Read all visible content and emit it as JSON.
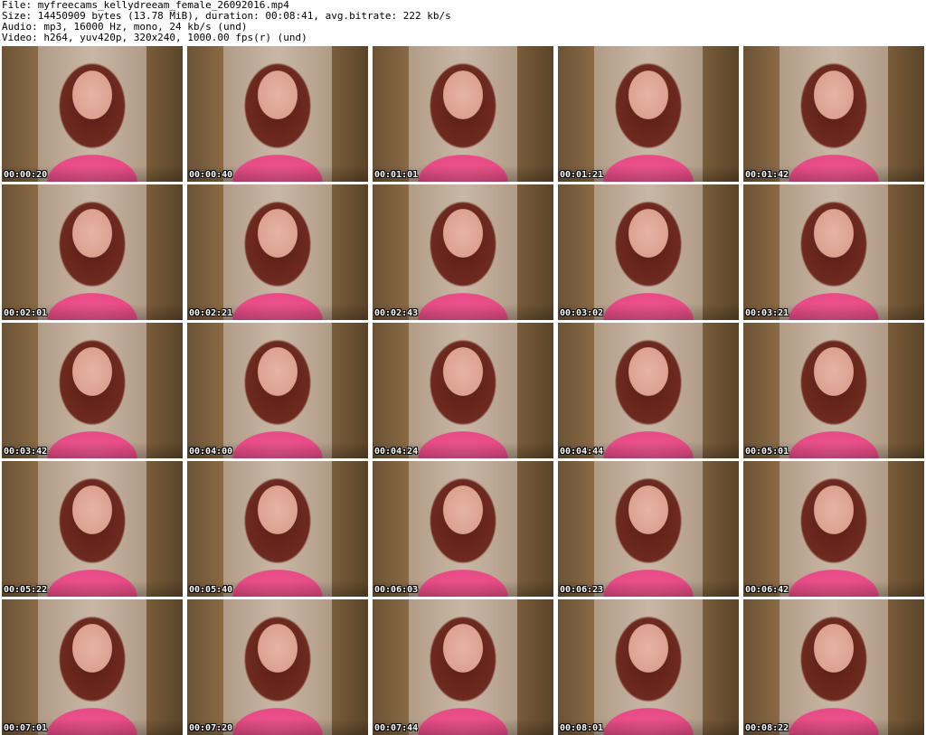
{
  "header": {
    "file": "File: myfreecams_kellydreeam_female_26092016.mp4",
    "size": "Size: 14450909 bytes (13.78 MiB), duration: 00:08:41, avg.bitrate: 222 kb/s",
    "audio": "Audio: mp3, 16000 Hz, mono, 24 kb/s (und)",
    "video": "Video: h264, yuv420p, 320x240, 1000.00 fps(r) (und)"
  },
  "thumbnails": [
    {
      "timestamp": "00:00:20"
    },
    {
      "timestamp": "00:00:40"
    },
    {
      "timestamp": "00:01:01"
    },
    {
      "timestamp": "00:01:21"
    },
    {
      "timestamp": "00:01:42"
    },
    {
      "timestamp": "00:02:01"
    },
    {
      "timestamp": "00:02:21"
    },
    {
      "timestamp": "00:02:43"
    },
    {
      "timestamp": "00:03:02"
    },
    {
      "timestamp": "00:03:21"
    },
    {
      "timestamp": "00:03:42"
    },
    {
      "timestamp": "00:04:00"
    },
    {
      "timestamp": "00:04:24"
    },
    {
      "timestamp": "00:04:44"
    },
    {
      "timestamp": "00:05:01"
    },
    {
      "timestamp": "00:05:22"
    },
    {
      "timestamp": "00:05:40"
    },
    {
      "timestamp": "00:06:03"
    },
    {
      "timestamp": "00:06:23"
    },
    {
      "timestamp": "00:06:42"
    },
    {
      "timestamp": "00:07:01"
    },
    {
      "timestamp": "00:07:20"
    },
    {
      "timestamp": "00:07:44"
    },
    {
      "timestamp": "00:08:01"
    },
    {
      "timestamp": "00:08:22"
    }
  ]
}
